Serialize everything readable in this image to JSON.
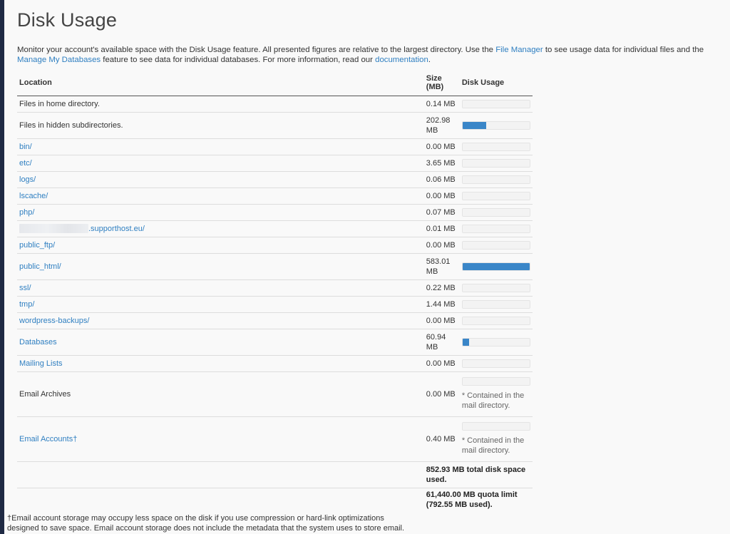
{
  "page": {
    "title": "Disk Usage",
    "intro": {
      "t1": "Monitor your account's available space with the Disk Usage feature. All presented figures are relative to the largest directory. Use the ",
      "file_manager_link": "File Manager",
      "t2": " to see usage data for individual files and the ",
      "manage_db_link": "Manage My Databases",
      "t3": " feature to see data for individual databases. For more information, read our ",
      "documentation_link": "documentation",
      "t4": "."
    }
  },
  "table": {
    "headers": {
      "location": "Location",
      "size": "Size (MB)",
      "usage": "Disk Usage"
    },
    "rows": [
      {
        "location": "Files in home directory.",
        "size": "0.14 MB",
        "usage_fraction": 0.0
      },
      {
        "location": "Files in hidden subdirectories.",
        "size": "202.98 MB",
        "usage_fraction": 0.35
      },
      {
        "location": "bin/",
        "size": "0.00 MB",
        "usage_fraction": 0.0
      },
      {
        "location": "etc/",
        "size": "3.65 MB",
        "usage_fraction": 0.0
      },
      {
        "location": "logs/",
        "size": "0.06 MB",
        "usage_fraction": 0.0
      },
      {
        "location": "lscache/",
        "size": "0.00 MB",
        "usage_fraction": 0.0
      },
      {
        "location": "php/",
        "size": "0.07 MB",
        "usage_fraction": 0.0
      },
      {
        "location": ".supporthost.eu/",
        "size": "0.01 MB",
        "usage_fraction": 0.0
      },
      {
        "location": "public_ftp/",
        "size": "0.00 MB",
        "usage_fraction": 0.0
      },
      {
        "location": "public_html/",
        "size": "583.01 MB",
        "usage_fraction": 1.0
      },
      {
        "location": "ssl/",
        "size": "0.22 MB",
        "usage_fraction": 0.0
      },
      {
        "location": "tmp/",
        "size": "1.44 MB",
        "usage_fraction": 0.0
      },
      {
        "location": "wordpress-backups/",
        "size": "0.00 MB",
        "usage_fraction": 0.0
      },
      {
        "location": "Databases",
        "size": "60.94 MB",
        "usage_fraction": 0.1
      },
      {
        "location": "Mailing Lists",
        "size": "0.00 MB",
        "usage_fraction": 0.0
      },
      {
        "location": "Email Archives",
        "size": "0.00 MB",
        "usage_fraction": 0.0,
        "note": "* Contained in the mail directory."
      },
      {
        "location": "Email Accounts†",
        "size": "0.40 MB",
        "usage_fraction": 0.0,
        "note": "* Contained in the mail directory."
      }
    ],
    "total_used": "852.93 MB total disk space used.",
    "quota": "61,440.00 MB quota limit (792.55 MB used)."
  },
  "footnote": "†Email account storage may occupy less space on the disk if you use compression or hard-link optimizations designed to save space. Email account storage does not include the metadata that the system uses to store email.",
  "colors": {
    "link": "#2f7fc1",
    "bar": "#3a86c8",
    "background": "#f9f9f9",
    "rail": "#1f2a44"
  }
}
